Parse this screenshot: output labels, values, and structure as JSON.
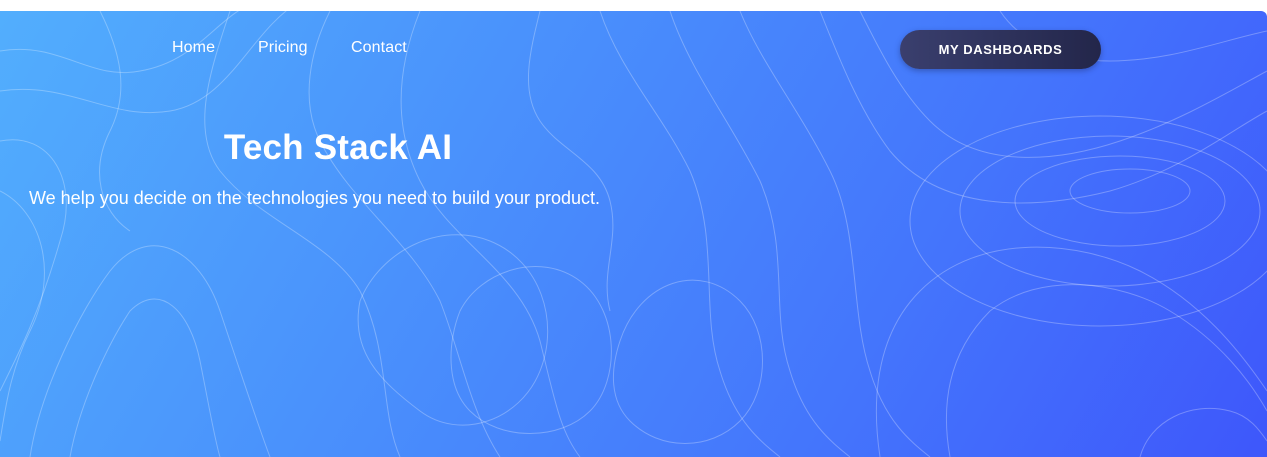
{
  "nav": {
    "items": [
      {
        "label": "Home"
      },
      {
        "label": "Pricing"
      },
      {
        "label": "Contact"
      }
    ]
  },
  "header": {
    "dashboards_button": "MY DASHBOARDS"
  },
  "hero": {
    "title": "Tech Stack AI",
    "subtitle": "We help you decide on the technologies you need to build your product."
  },
  "colors": {
    "gradient_start": "#52aefd",
    "gradient_end": "#3e57fb",
    "button_bg": "#2a2e58",
    "text": "#ffffff"
  }
}
